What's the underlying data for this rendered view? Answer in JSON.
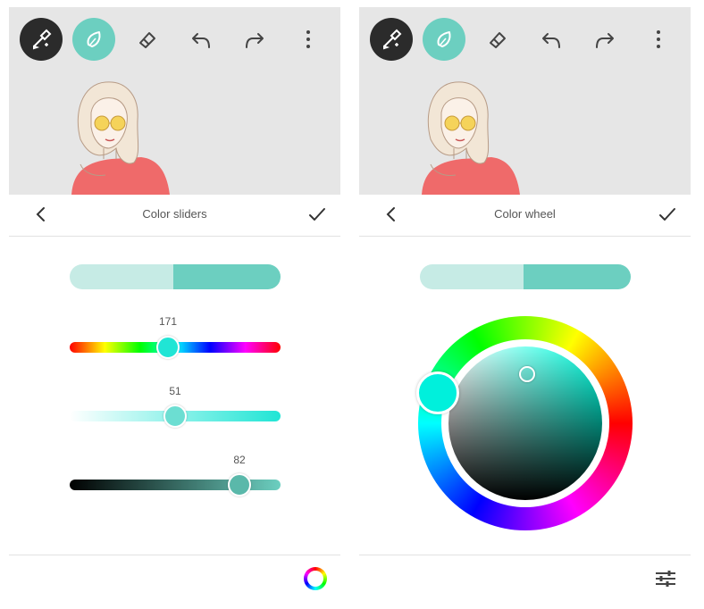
{
  "left_panel": {
    "header": {
      "title": "Color sliders"
    },
    "sliders": [
      {
        "name": "hue",
        "value": "171"
      },
      {
        "name": "saturation",
        "value": "51"
      },
      {
        "name": "brightness",
        "value": "82"
      }
    ],
    "footer_icon": "color-wheel-icon"
  },
  "right_panel": {
    "header": {
      "title": "Color wheel"
    },
    "footer_icon": "sliders-icon"
  },
  "toolbar": {
    "tools": [
      "brush-settings-icon",
      "blend-icon",
      "eraser-icon",
      "undo-icon",
      "redo-icon",
      "more-icon"
    ]
  },
  "colors": {
    "accent": "#6ccfc0",
    "previous_color": "#c6ebe5",
    "current_color": "#6ccfc0",
    "hue_color": "#00ffe0",
    "canvas_background": "#e6e6e6",
    "dark_tool": "#2b2b2b"
  }
}
